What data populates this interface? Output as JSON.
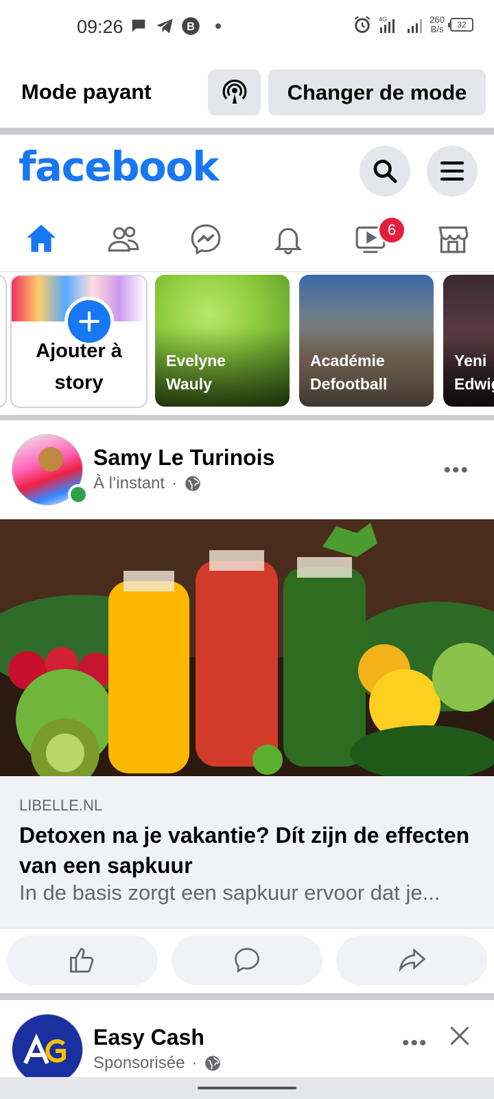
{
  "status_bar": {
    "time": "09:26",
    "net_speed_value": "260",
    "net_speed_unit": "B/s",
    "network": "4G",
    "battery": "32"
  },
  "mode_bar": {
    "title": "Mode payant",
    "change_label": "Changer de mode"
  },
  "header": {
    "logo": "facebook",
    "brand_color": "#1877f2"
  },
  "nav": {
    "tabs": [
      {
        "icon": "home-icon",
        "active": true
      },
      {
        "icon": "friends-icon"
      },
      {
        "icon": "messenger-icon"
      },
      {
        "icon": "bell-icon"
      },
      {
        "icon": "video-icon",
        "badge": "6"
      },
      {
        "icon": "marketplace-icon"
      }
    ],
    "video_badge": "6"
  },
  "stories": {
    "add_label_line1": "Ajouter à",
    "add_label_line2": "story",
    "items": [
      {
        "name_line1": "Evelyne",
        "name_line2": "Wauly"
      },
      {
        "name_line1": "Académie",
        "name_line2": "Defootball"
      },
      {
        "name_line1": "Yeni",
        "name_line2": "Edwig"
      }
    ]
  },
  "post": {
    "author": "Samy Le Turinois",
    "time": "À l’instant",
    "separator": "·",
    "link": {
      "domain": "LIBELLE.NL",
      "title": "Detoxen na je vakantie? Dít zijn de effecten van een sapkuur",
      "description": "In de basis zorgt een sapkuur ervoor dat je..."
    }
  },
  "sponsored": {
    "name": "Easy Cash",
    "label": "Sponsorisée",
    "separator": "·"
  }
}
